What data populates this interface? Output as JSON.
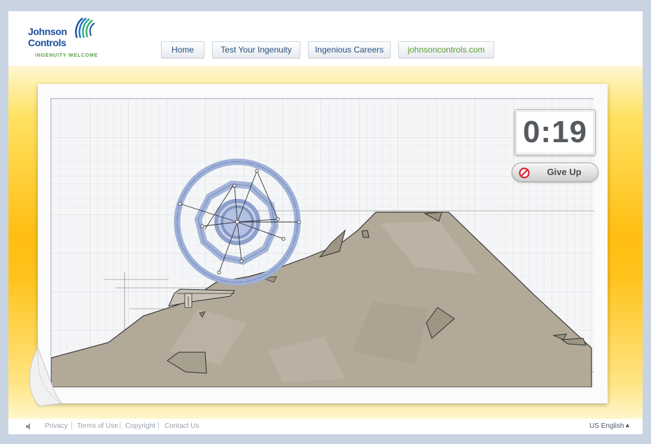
{
  "brand": {
    "line1": "Johnson",
    "line2": "Controls",
    "tagline": "INGENUITY WELCOME",
    "colors": {
      "blue": "#1b4f9c",
      "green": "#5aa24a",
      "teal": "#22a39c"
    }
  },
  "nav": {
    "items": [
      {
        "label": "Home"
      },
      {
        "label": "Test Your Ingenuity"
      },
      {
        "label": "Ingenious Careers"
      },
      {
        "label": "johnsoncontrols.com"
      }
    ]
  },
  "game": {
    "timer": "0:19",
    "give_up_label": "Give Up",
    "colors": {
      "mountain": "#b3a999",
      "wheel": "#9fb1d8",
      "stage_yellow": "#ffc31c"
    }
  },
  "footer": {
    "links": [
      "Privacy",
      "Terms of Use",
      "Copyright",
      "Contact Us"
    ],
    "language": "US English"
  }
}
